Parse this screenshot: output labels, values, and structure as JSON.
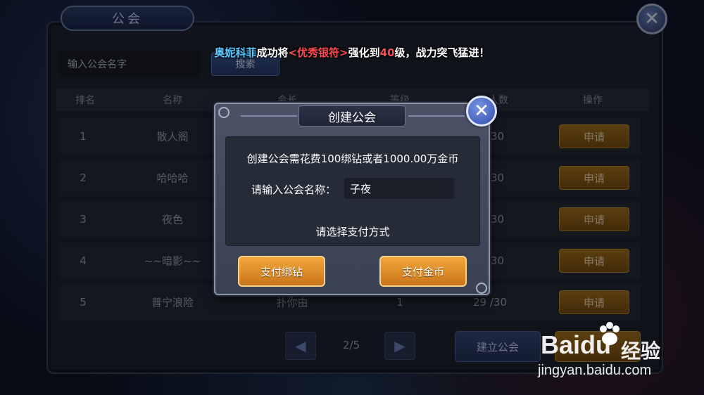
{
  "panel": {
    "title": "公会",
    "search_placeholder": "输入公会名字",
    "search_label": "搜索",
    "columns": [
      "排名",
      "名称",
      "会长",
      "等级",
      "人数",
      "操作"
    ],
    "rows": [
      {
        "rank": "1",
        "name": "散人阁",
        "leader": "",
        "level": "",
        "members": "/30",
        "action": "申请"
      },
      {
        "rank": "2",
        "name": "哈哈哈",
        "leader": "",
        "level": "",
        "members": "/30",
        "action": "申请"
      },
      {
        "rank": "3",
        "name": "夜色",
        "leader": "",
        "level": "",
        "members": "/30",
        "action": "申请"
      },
      {
        "rank": "4",
        "name": "~~暗影~~",
        "leader": "",
        "level": "",
        "members": "/30",
        "action": "申请"
      },
      {
        "rank": "5",
        "name": "普宁浪险",
        "leader": "扑你由",
        "level": "1",
        "members": "29 /30",
        "action": "申请"
      }
    ],
    "pager": {
      "text": "2/5"
    },
    "build_label": "建立公会"
  },
  "broadcast": {
    "who": "奥妮科菲",
    "part1": "成功将",
    "item": "<优秀银符>",
    "part2": "强化到",
    "level": "40",
    "part3": "级，战力突飞猛进！"
  },
  "dialog": {
    "title": "创建公会",
    "cost_text": "创建公会需花费100绑钻或者1000.00万金币",
    "name_label": "请输入公会名称：",
    "name_value": "子夜",
    "pay_hint": "请选择支付方式",
    "pay_bound_diamond": "支付绑钻",
    "pay_gold": "支付金币"
  },
  "watermark": {
    "brand": "Bai",
    "brand_tail": "du",
    "cn": "经验",
    "url": "jingyan.baidu.com"
  },
  "icons": {
    "close": "close-icon",
    "prev": "chevron-left-icon",
    "next": "chevron-right-icon"
  },
  "colors": {
    "broadcast_name": "#5ec8ff",
    "broadcast_item": "#ff4b52",
    "pay_button": "#f2a63a",
    "apply_button": "#a8731e"
  }
}
